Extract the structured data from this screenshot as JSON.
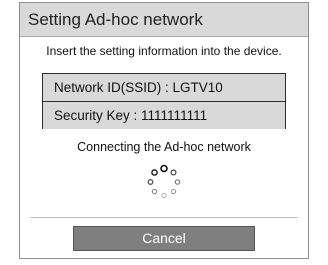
{
  "dialog": {
    "title": "Setting Ad-hoc network",
    "instruction": "Insert the setting information into the device.",
    "info": {
      "network_id_text": "Network ID(SSID) : LGTV10",
      "security_key_text": "Security Key : 1111111111"
    },
    "status": "Connecting the Ad-hoc network",
    "spinner_icon": "loading-spinner-icon",
    "cancel_label": "Cancel"
  },
  "colors": {
    "title_bar": "#d9d9d9",
    "info_rows": "#d9d9d9",
    "button": "#7f7f7f",
    "button_text": "#ffffff"
  }
}
